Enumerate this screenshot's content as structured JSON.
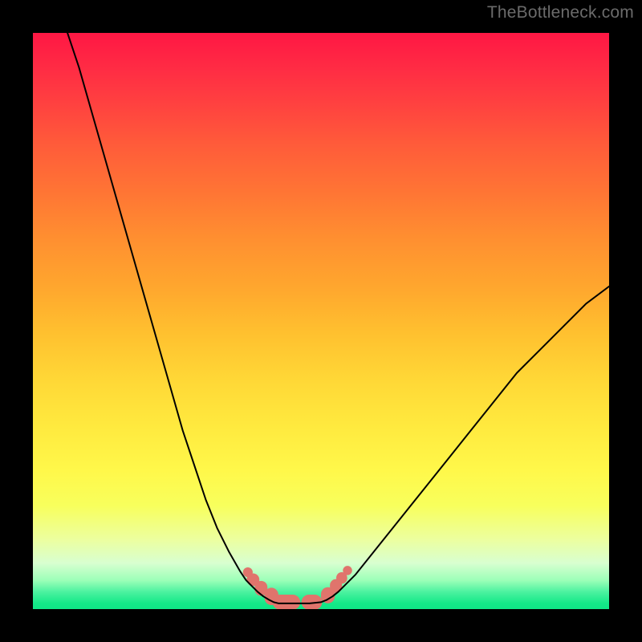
{
  "watermark": "TheBottleneck.com",
  "chart_data": {
    "type": "line",
    "title": "",
    "xlabel": "",
    "ylabel": "",
    "xlim": [
      0,
      100
    ],
    "ylim": [
      0,
      100
    ],
    "grid": false,
    "legend": false,
    "background_gradient": {
      "top": "#ff1744",
      "mid": "#ffe040",
      "bottom": "#10e686"
    },
    "series": [
      {
        "name": "bottleneck-curve",
        "color": "#000000",
        "x": [
          6,
          8,
          10,
          12,
          14,
          16,
          18,
          20,
          22,
          24,
          26,
          28,
          30,
          32,
          34,
          36,
          37,
          38,
          39,
          40,
          41,
          41.8,
          42.6,
          44,
          46,
          48,
          50,
          51,
          52,
          53,
          54,
          56,
          60,
          64,
          68,
          72,
          76,
          80,
          84,
          88,
          92,
          96,
          100
        ],
        "y": [
          100,
          94,
          87,
          80,
          73,
          66,
          59,
          52,
          45,
          38,
          31,
          25,
          19,
          14,
          10,
          6.5,
          5.0,
          4.0,
          3.0,
          2.2,
          1.6,
          1.2,
          1.0,
          1.0,
          1.0,
          1.0,
          1.2,
          1.6,
          2.2,
          3.0,
          4.0,
          6.0,
          11,
          16,
          21,
          26,
          31,
          36,
          41,
          45,
          49,
          53,
          56
        ]
      }
    ],
    "markers": [
      {
        "name": "range-dots",
        "color": "#e0746c",
        "shape": "rounded",
        "points": [
          {
            "x": 37.3,
            "y": 6.4,
            "w": 1.7,
            "h": 1.7
          },
          {
            "x": 38.2,
            "y": 5.1,
            "w": 2.2,
            "h": 2.2
          },
          {
            "x": 39.6,
            "y": 3.6,
            "w": 2.2,
            "h": 2.6
          },
          {
            "x": 41.4,
            "y": 2.2,
            "w": 2.4,
            "h": 3.0
          },
          {
            "x": 44.0,
            "y": 1.2,
            "w": 4.8,
            "h": 2.6
          },
          {
            "x": 48.4,
            "y": 1.2,
            "w": 3.6,
            "h": 2.6
          },
          {
            "x": 51.2,
            "y": 2.4,
            "w": 2.4,
            "h": 2.8
          },
          {
            "x": 52.6,
            "y": 4.0,
            "w": 2.1,
            "h": 2.4
          },
          {
            "x": 53.6,
            "y": 5.4,
            "w": 1.9,
            "h": 2.0
          },
          {
            "x": 54.6,
            "y": 6.7,
            "w": 1.6,
            "h": 1.6
          }
        ]
      }
    ]
  }
}
